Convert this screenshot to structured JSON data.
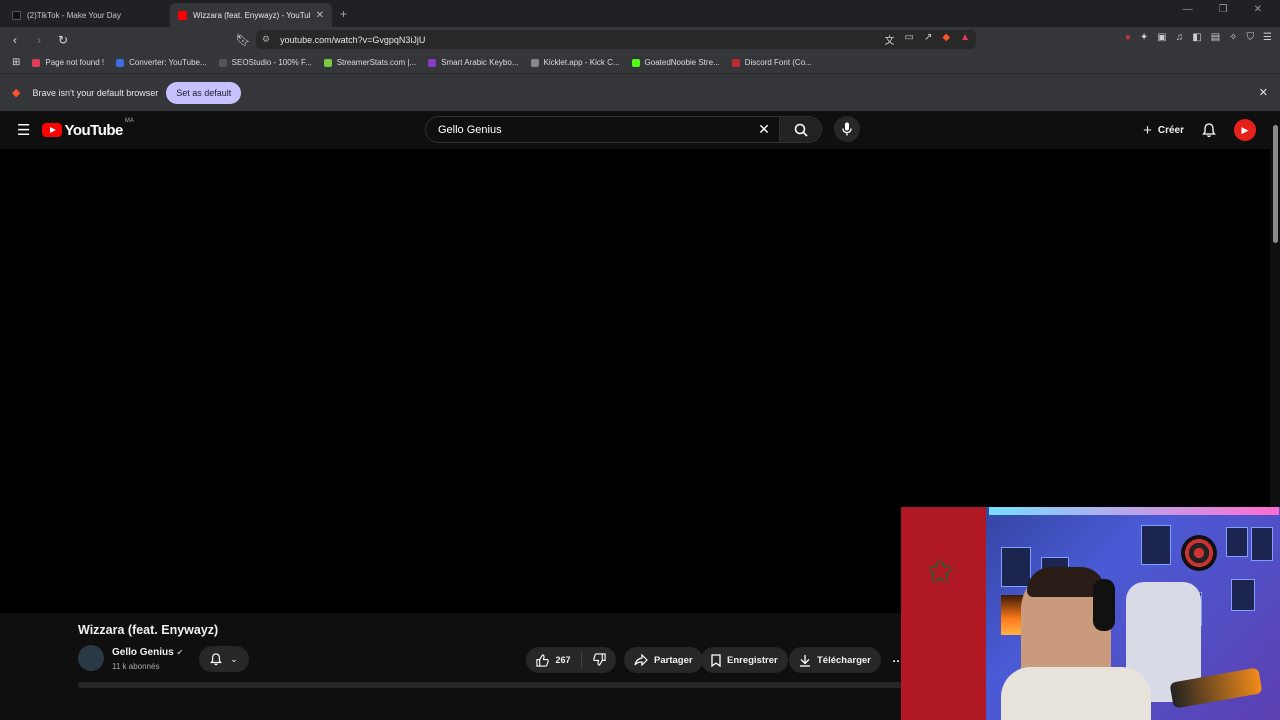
{
  "browser": {
    "tabs": [
      {
        "title": "(2)TikTok - Make Your Day",
        "active": false
      },
      {
        "title": "Wizzara (feat. Enywayz) - YouTube",
        "active": true
      }
    ],
    "url": "youtube.com/watch?v=GvgpqN3iJjU",
    "bookmarks": [
      {
        "label": "Page not found !",
        "color": "#e33b5a"
      },
      {
        "label": "Converter: YouTube...",
        "color": "#3b6ee3"
      },
      {
        "label": "SEOStudio - 100% F...",
        "color": "#555555"
      },
      {
        "label": "StreamerStats.com |...",
        "color": "#7ac943"
      },
      {
        "label": "Smart Arabic Keybo...",
        "color": "#8a3bc9"
      },
      {
        "label": "Kicklet.app - Kick C...",
        "color": "#888888"
      },
      {
        "label": "GoatedNoobie Stre...",
        "color": "#53fc18"
      },
      {
        "label": "Discord Font (Co...",
        "color": "#c02b2b"
      }
    ],
    "infobar": {
      "message": "Brave isn't your default browser",
      "button": "Set as default"
    }
  },
  "youtube": {
    "logo_text": "YouTube",
    "country_code": "MA",
    "search_query": "Gello Genius",
    "create_label": "Créer",
    "video_title": "Wizzara (feat. Enywayz)",
    "channel_name": "Gello Genius",
    "subscribers": "11 k abonnés",
    "likes": "267",
    "share_label": "Partager",
    "save_label": "Enregistrer",
    "download_label": "Télécharger",
    "more_label": "…"
  },
  "colors": {
    "brand_red": "#ff0000",
    "infobar_button": "#c6c1ff",
    "background": "#0f0f0f"
  }
}
